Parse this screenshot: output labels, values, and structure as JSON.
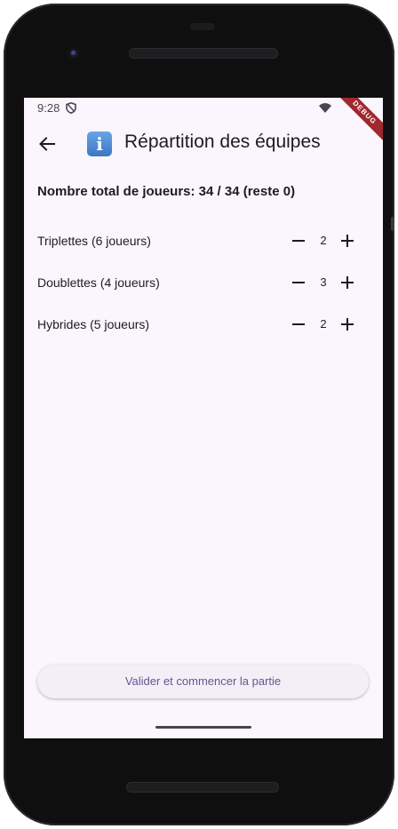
{
  "status_bar": {
    "time": "9:28",
    "debug_banner": "DEBUG"
  },
  "app_bar": {
    "title": "Répartition des équipes",
    "info_icon_glyph": "i"
  },
  "summary": {
    "total_text": "Nombre total de joueurs: 34 / 34 (reste 0)"
  },
  "teams": [
    {
      "label": "Triplettes (6 joueurs)",
      "count": "2"
    },
    {
      "label": "Doublettes (4 joueurs)",
      "count": "3"
    },
    {
      "label": "Hybrides (5 joueurs)",
      "count": "2"
    }
  ],
  "actions": {
    "validate_label": "Valider et commencer la partie"
  },
  "colors": {
    "background": "#fbf6fd",
    "primary": "#65558f",
    "text": "#1d1b20",
    "debug": "#a0282e"
  }
}
